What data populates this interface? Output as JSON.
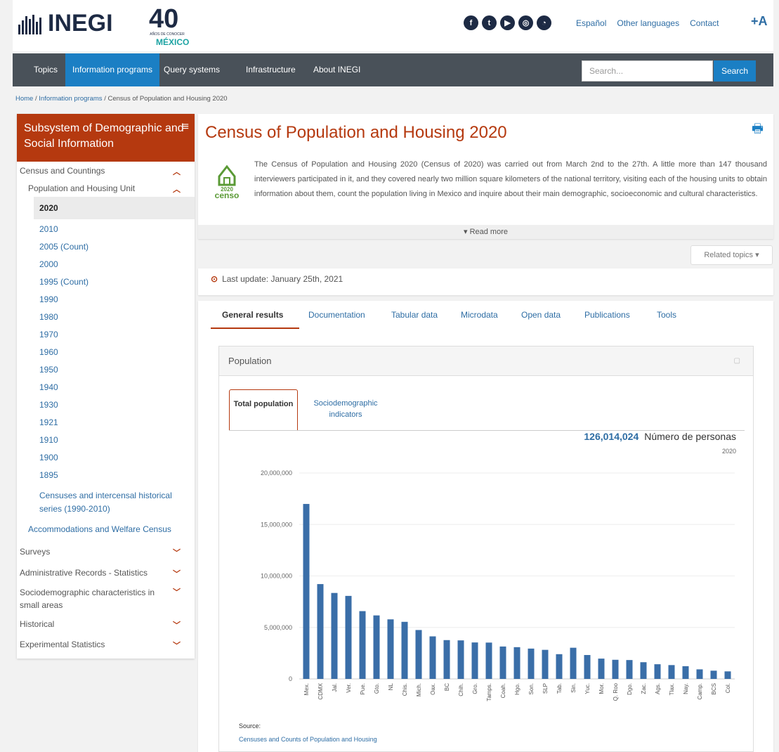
{
  "header": {
    "logo_text": "INEGI",
    "anniversary": {
      "number": "40",
      "subtitle": "AÑOS DE CONOCER",
      "country": "MÉXICO"
    },
    "social_icons": [
      "facebook-icon",
      "twitter-icon",
      "youtube-icon",
      "instagram-icon",
      "rss-icon"
    ],
    "links": [
      "Español",
      "Other languages",
      "Contact"
    ],
    "font_size_button": "+A"
  },
  "nav": {
    "items": [
      "Topics",
      "Information programs",
      "Query systems",
      "Infrastructure",
      "About INEGI"
    ],
    "active": "Information programs",
    "search_placeholder": "Search...",
    "search_button": "Search"
  },
  "breadcrumb": {
    "home": "Home",
    "programs": "Information programs",
    "current": "Census of Population and Housing 2020",
    "separator": " / "
  },
  "sidebar": {
    "title": "Subsystem of Demographic and Social Information",
    "census_group": "Census and Countings",
    "population_unit": "Population and Housing Unit",
    "years": [
      "2020",
      "2010",
      "2005 (Count)",
      "2000",
      "1995 (Count)",
      "1990",
      "1980",
      "1970",
      "1960",
      "1950",
      "1940",
      "1930",
      "1921",
      "1910",
      "1900",
      "1895"
    ],
    "selected_year": "2020",
    "historic_series": "Censuses and intercensal historical series (1990-2010)",
    "accommodations": "Accommodations and Welfare Census",
    "groups": [
      "Surveys",
      "Administrative Records - Statistics",
      "Sociodemographic characteristics in small areas",
      "Historical",
      "Experimental Statistics"
    ]
  },
  "main": {
    "title": "Census of Population and Housing 2020",
    "censo_logo": {
      "year": "2020",
      "word": "censo"
    },
    "intro": "The Census of Population and Housing 2020 (Census of 2020) was carried out from March 2nd to the 27th. A little more than 147 thousand interviewers participated in it, and they covered nearly two million square kilometers of the national territory, visiting each of the housing units to obtain information about them, count the population living in Mexico and inquire about their main demographic, socioeconomic and cultural characteristics.",
    "read_more": "▾ Read more",
    "related_topics": "Related topics ▾",
    "last_update": "Last update: January 25th, 2021",
    "tabs": [
      "General results",
      "Documentation",
      "Tabular data",
      "Microdata",
      "Open data",
      "Publications",
      "Tools"
    ],
    "active_tab": "General results"
  },
  "population_panel": {
    "title": "Population",
    "subtab_total": "Total population",
    "subtab_indicators": "Sociodemographic indicators",
    "total_value": "126,014,024",
    "total_unit": "Número de personas",
    "total_year": "2020",
    "source_label": "Source:",
    "source_link": "Censuses and Counts of Population and Housing"
  },
  "colors": {
    "accent": "#b5390f",
    "link": "#2e6da4",
    "nav_bg": "#495159",
    "nav_active": "#1b7fc4",
    "bar": "#3a6ea8"
  },
  "chart_data": {
    "type": "bar",
    "categories": [
      "Mex.",
      "CDMX",
      "Jal.",
      "Ver.",
      "Pue.",
      "Gto.",
      "NL",
      "Chis.",
      "Mich.",
      "Oax.",
      "BC",
      "Chih.",
      "Gro.",
      "Tamps.",
      "Coah.",
      "Hgo.",
      "Son.",
      "SLP",
      "Tab.",
      "Sin.",
      "Yuc.",
      "Mor.",
      "Q. Roo",
      "Dgo.",
      "Zac.",
      "Ags.",
      "Tlax.",
      "Nay.",
      "Camp.",
      "BCS",
      "Col."
    ],
    "values": [
      16992418,
      9209944,
      8348151,
      8062579,
      6583278,
      6166934,
      5784442,
      5543828,
      4748846,
      4132148,
      3769020,
      3741869,
      3540685,
      3527735,
      3146771,
      3082841,
      2944840,
      2822255,
      2402598,
      3026943,
      2320898,
      1971520,
      1857985,
      1832650,
      1622138,
      1425607,
      1342977,
      1235456,
      928363,
      798447,
      731391
    ],
    "ylim": [
      0,
      20000000
    ],
    "yticks": [
      "0",
      "5,000,000",
      "10,000,000",
      "15,000,000",
      "20,000,000"
    ],
    "ytick_values": [
      0,
      5000000,
      10000000,
      15000000,
      20000000
    ]
  }
}
